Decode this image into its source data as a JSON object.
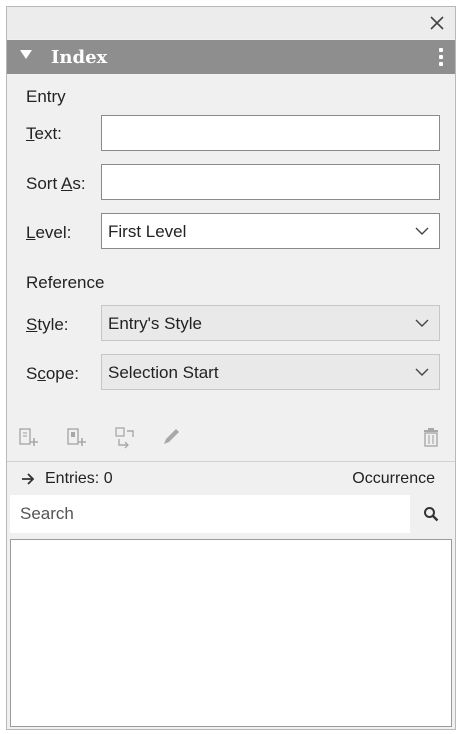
{
  "panel": {
    "title": "Index"
  },
  "entry": {
    "section_label": "Entry",
    "text_label_mnemonic": "T",
    "text_label_rest": "ext:",
    "text_value": "",
    "sort_label_pre": "Sort ",
    "sort_label_mnemonic": "A",
    "sort_label_rest": "s:",
    "sort_value": "",
    "level_label_mnemonic": "L",
    "level_label_rest": "evel:",
    "level_value": "First Level"
  },
  "reference": {
    "section_label": "Reference",
    "style_label_mnemonic": "S",
    "style_label_rest": "tyle:",
    "style_value": "Entry's Style",
    "scope_label_pre": "S",
    "scope_label_mnemonic": "c",
    "scope_label_rest": "ope:",
    "scope_value": "Selection Start"
  },
  "toolbar": {
    "icons": [
      "new-entry-icon",
      "new-reference-icon",
      "go-to-reference-icon",
      "edit-icon",
      "delete-icon"
    ]
  },
  "entries": {
    "label": "Entries: 0",
    "occurrence_label": "Occurrence"
  },
  "search": {
    "placeholder": "Search",
    "value": ""
  },
  "colors": {
    "header_bg": "#8e8e8e",
    "panel_bg": "#f0f0f0",
    "icon_grey": "#a8a8a8"
  }
}
